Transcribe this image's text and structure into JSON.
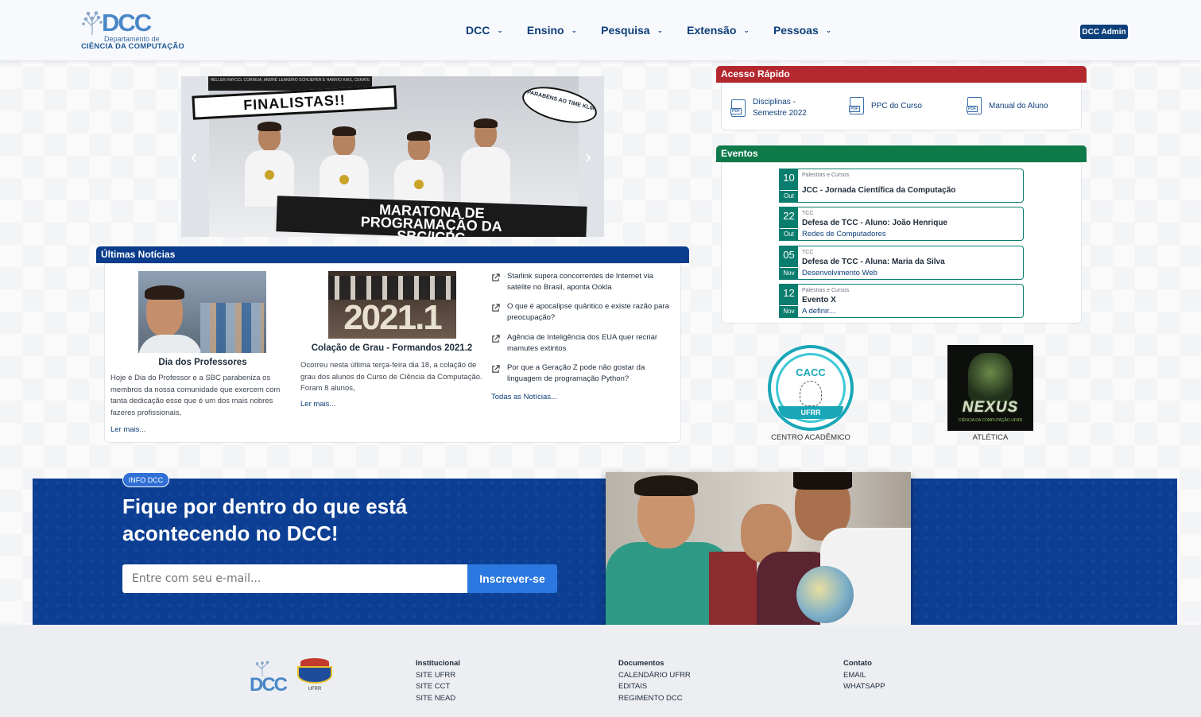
{
  "header": {
    "logo_dcc": "DCC",
    "logo_dept": "Departamento de",
    "logo_cc": "CIÊNCIA DA COMPUTAÇÃO",
    "nav": [
      {
        "label": "DCC"
      },
      {
        "label": "Ensino"
      },
      {
        "label": "Pesquisa"
      },
      {
        "label": "Extensão"
      },
      {
        "label": "Pessoas"
      }
    ],
    "admin_label": "DCC Admin"
  },
  "carousel": {
    "top_caption": "HELLER RAYCCL CORREIA, ANDRÉ LEANDRO SCHLIEPER E HARRIO KAIS, CERATE",
    "finalistas": "FINALISTAS!!",
    "parabens": "PARABÉNS AO TIME KLM",
    "banner_line1": "MARATONA DE",
    "banner_line2": "PROGRAMAÇÃO DA",
    "banner_line3": "SBC/ICPC",
    "prev": "‹",
    "next": "›"
  },
  "quick_access": {
    "title": "Acesso Rápido",
    "items": [
      {
        "label": "Disciplinas - Semestre 2022"
      },
      {
        "label": "PPC do Curso"
      },
      {
        "label": "Manual do Aluno"
      }
    ],
    "pdf_tag": "PDF"
  },
  "events": {
    "title": "Eventos",
    "items": [
      {
        "day": "10",
        "month": "Out",
        "category": "Palestras e Cursos",
        "title": "JCC - Jornada Científica da Computação",
        "subtitle": ""
      },
      {
        "day": "22",
        "month": "Out",
        "category": "TCC",
        "title": "Defesa de TCC - Aluno: João Henrique",
        "subtitle": "Redes de Computadores"
      },
      {
        "day": "05",
        "month": "Nov",
        "category": "TCC",
        "title": "Defesa de TCC - Aluna: Maria da Silva",
        "subtitle": "Desenvolvimento Web"
      },
      {
        "day": "12",
        "month": "Nov",
        "category": "Palestras e Cursos",
        "title": "Evento X",
        "subtitle": "A definir..."
      }
    ]
  },
  "logos": {
    "cacc_text": "CACC",
    "cacc_ufrr": "UFRR",
    "cacc_caption": "CENTRO ACADÊMICO",
    "nexus_word": "NEXUS",
    "nexus_small": "CIÊNCIA DA COMPUTAÇÃO UFRR",
    "nexus_caption": "ATLÉTICA"
  },
  "news": {
    "title": "Últimas Notícias",
    "cards": [
      {
        "title": "Dia dos Professores",
        "text": "Hoje é Dia do Professor e a SBC parabeniza os membros da nossa comunidade que exercem com tanta dedicação esse que é um dos mais nobres fazeres profissionais,",
        "read_more": "Ler mais..."
      },
      {
        "title": "Colação de Grau - Formandos 2021.2",
        "text": "Ocorreu nesta última terça-feira dia 18, a colação de grau dos alunos do Curso de Ciência da Computação. Foram 8 alunos,",
        "read_more": "Ler mais...",
        "photo_text": "2021.1"
      }
    ],
    "links": [
      {
        "label": "Starlink supera concorrentes de Internet via satélite no Brasil, aponta Ookla"
      },
      {
        "label": "O que é apocalipse quântico e existe razão para preocupação?"
      },
      {
        "label": "Agência de Inteligência dos EUA quer recriar mamutes extintos"
      },
      {
        "label": "Por que a Geração Z pode não gostar da linguagem de programação Python?"
      }
    ],
    "all_news": "Todas as Notícias..."
  },
  "newsletter": {
    "badge": "INFO DCC",
    "title": "Fique por dentro do que está acontecendo no DCC!",
    "placeholder": "Entre com seu e-mail...",
    "button": "Inscrever-se"
  },
  "footer": {
    "logo_dcc": "DCC",
    "logo_ufrr": "UFRR",
    "columns": [
      {
        "heading": "Institucional",
        "links": [
          "SITE UFRR",
          "SITE CCT",
          "SITE NEAD"
        ]
      },
      {
        "heading": "Documentos",
        "links": [
          "CALENDÁRIO UFRR",
          "EDITAIS",
          "REGIMENTO DCC"
        ]
      },
      {
        "heading": "Contato",
        "links": [
          "EMAIL",
          "WHATSAPP"
        ]
      }
    ]
  },
  "colors": {
    "primary": "#0d3f7a",
    "quick_access": "#b3282e",
    "events": "#0e7a4a",
    "news": "#0b3d8c",
    "newsletter": "#0c3f93"
  }
}
